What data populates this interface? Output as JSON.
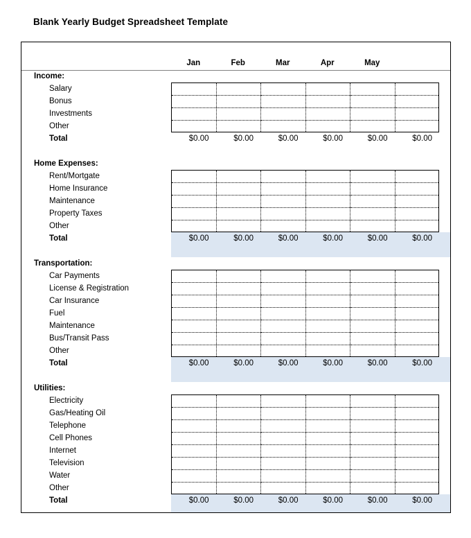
{
  "document": {
    "title": "Blank Yearly Budget Spreadsheet Template"
  },
  "colors": {
    "total_highlight": "#dce6f2",
    "border": "#000000",
    "header_rule": "#808080"
  },
  "table": {
    "months": [
      "Jan",
      "Feb",
      "Mar",
      "Apr",
      "May"
    ],
    "column_count": 6,
    "total_label": "Total",
    "zero_value": "$0.00"
  },
  "sections": [
    {
      "title": "Income:",
      "highlight_total": false,
      "items": [
        "Salary",
        "Bonus",
        "Investments",
        "Other"
      ],
      "totals": [
        "$0.00",
        "$0.00",
        "$0.00",
        "$0.00",
        "$0.00",
        "$0.00"
      ]
    },
    {
      "title": "Home Expenses:",
      "highlight_total": true,
      "items": [
        "Rent/Mortgate",
        "Home Insurance",
        "Maintenance",
        "Property Taxes",
        "Other"
      ],
      "totals": [
        "$0.00",
        "$0.00",
        "$0.00",
        "$0.00",
        "$0.00",
        "$0.00"
      ]
    },
    {
      "title": "Transportation:",
      "highlight_total": true,
      "items": [
        "Car Payments",
        "License & Registration",
        "Car Insurance",
        "Fuel",
        "Maintenance",
        "Bus/Transit Pass",
        "Other"
      ],
      "totals": [
        "$0.00",
        "$0.00",
        "$0.00",
        "$0.00",
        "$0.00",
        "$0.00"
      ]
    },
    {
      "title": "Utilities:",
      "highlight_total": true,
      "items": [
        "Electricity",
        "Gas/Heating Oil",
        "Telephone",
        "Cell Phones",
        "Internet",
        "Television",
        "Water",
        "Other"
      ],
      "totals": [
        "$0.00",
        "$0.00",
        "$0.00",
        "$0.00",
        "$0.00",
        "$0.00"
      ]
    }
  ]
}
